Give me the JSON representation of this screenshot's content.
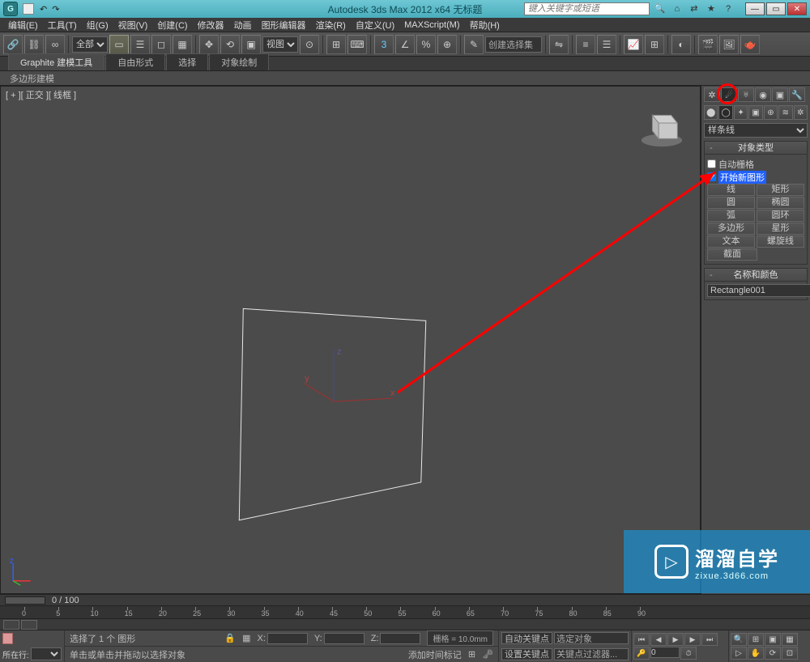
{
  "titlebar": {
    "app_title": "Autodesk 3ds Max 2012 x64   无标题",
    "search_placeholder": "键入关键字或短语",
    "logo_text": "G"
  },
  "menu": {
    "items": [
      "编辑(E)",
      "工具(T)",
      "组(G)",
      "视图(V)",
      "创建(C)",
      "修改器",
      "动画",
      "图形编辑器",
      "渲染(R)",
      "自定义(U)",
      "MAXScript(M)",
      "帮助(H)"
    ]
  },
  "toolbar": {
    "scope_select": "全部",
    "view_select": "视图",
    "selset_input": "创建选择集"
  },
  "ribbon": {
    "tabs": [
      "Graphite 建模工具",
      "自由形式",
      "选择",
      "对象绘制"
    ],
    "sub": "多边形建模"
  },
  "viewport": {
    "label": "[ + ][ 正交 ][ 线框 ]"
  },
  "panel": {
    "category": "样条线",
    "rollout_objtype": "对象类型",
    "autogrid": "自动栅格",
    "startshape": "开始新图形",
    "buttons": [
      [
        "线",
        "矩形"
      ],
      [
        "圆",
        "椭圆"
      ],
      [
        "弧",
        "圆环"
      ],
      [
        "多边形",
        "星形"
      ],
      [
        "文本",
        "螺旋线"
      ],
      [
        "截面"
      ]
    ],
    "rollout_namecolor": "名称和颜色",
    "obj_name": "Rectangle001"
  },
  "trackbar": {
    "frames": "0 / 100"
  },
  "timeline": {
    "ticks": [
      0,
      5,
      10,
      15,
      20,
      25,
      30,
      35,
      40,
      45,
      50,
      55,
      60,
      65,
      70,
      75,
      80,
      85,
      90
    ]
  },
  "status": {
    "sel_info": "选择了 1 个 图形",
    "prompt": "单击或单击并拖动以选择对象",
    "add_time": "添加时间标记",
    "x_label": "X:",
    "y_label": "Y:",
    "z_label": "Z:",
    "grid": "栅格 = 10.0mm",
    "autokey": "自动关键点",
    "selset_label": "选定对象",
    "setkey": "设置关键点",
    "keyfilter": "关键点过滤器...",
    "curframe_label": "所在行:"
  },
  "watermark": {
    "brand": "溜溜自学",
    "url": "zixue.3d66.com"
  }
}
